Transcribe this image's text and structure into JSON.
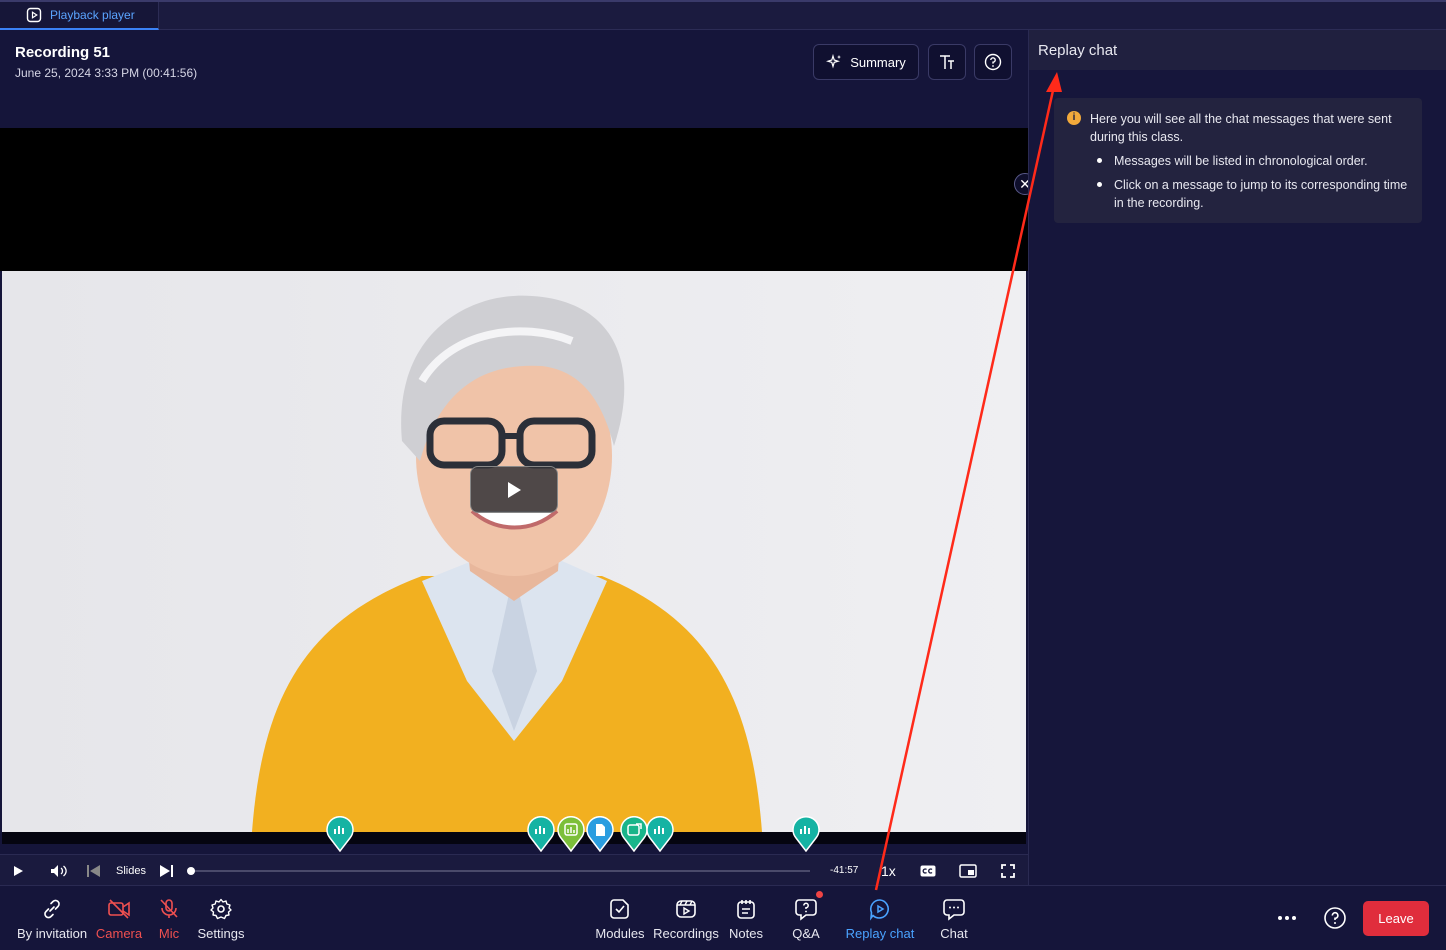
{
  "tab": {
    "label": "Playback player"
  },
  "recording": {
    "title": "Recording 51",
    "date": "June 25, 2024 3:33 PM (00:41:56)"
  },
  "header_buttons": {
    "summary": "Summary"
  },
  "player": {
    "slides_label": "Slides",
    "time_remaining": "-41:57",
    "speed": "1x"
  },
  "panel": {
    "title": "Replay chat",
    "info_text": "Here you will see all the chat messages that were sent during this class.",
    "bullets": [
      "Messages will be listed in chronological order.",
      "Click on a message to jump to its corresponding time in the recording."
    ]
  },
  "toolbar": {
    "by_invitation": "By invitation",
    "camera": "Camera",
    "mic": "Mic",
    "settings": "Settings",
    "modules": "Modules",
    "recordings": "Recordings",
    "notes": "Notes",
    "qa": "Q&A",
    "replay_chat": "Replay chat",
    "chat": "Chat",
    "leave": "Leave"
  },
  "colors": {
    "accent_blue": "#4aa3ff",
    "danger": "#e02d3c",
    "marker_teal": "#15b3a3",
    "marker_green": "#7cbf3a",
    "marker_blue": "#2a9de0"
  }
}
